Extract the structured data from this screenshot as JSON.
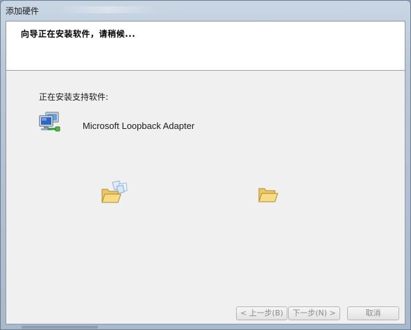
{
  "window": {
    "title": "添加硬件"
  },
  "header": {
    "title": "向导正在安装软件，请稍候..."
  },
  "main": {
    "installing_label": "正在安装支持软件:",
    "device_name": "Microsoft Loopback Adapter",
    "device_icon": "network-adapter-icon",
    "source_folder_icon": "folder-with-files-icon",
    "destination_folder_icon": "folder-icon"
  },
  "footer": {
    "back_label": "< 上一步(B)",
    "next_label": "下一步(N) >",
    "cancel_label": "取消"
  },
  "colors": {
    "client_bg": "#f0f0f0",
    "header_bg": "#ffffff",
    "disabled_text": "#8a8a8a"
  }
}
